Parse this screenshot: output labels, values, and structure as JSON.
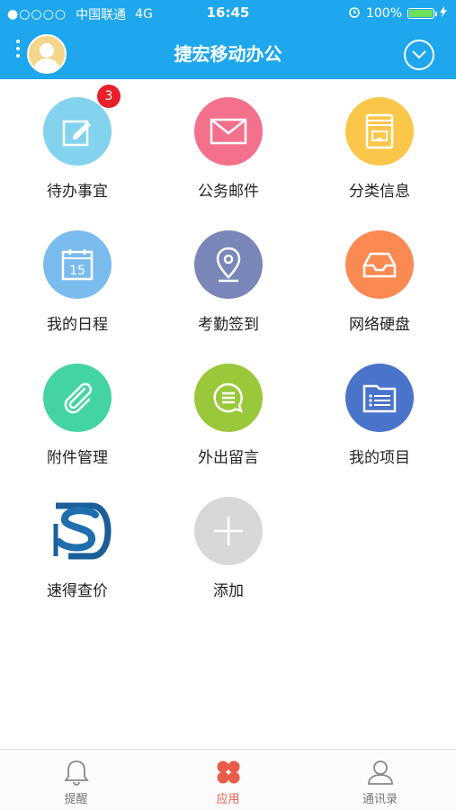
{
  "status": {
    "signal": "●○○○○",
    "carrier": "中国联通",
    "network": "4G",
    "time": "16:45",
    "battery": "100%"
  },
  "header": {
    "title": "捷宏移动办公"
  },
  "apps": [
    {
      "label": "待办事宜",
      "badge": "3",
      "color": "#83d3ee",
      "icon": "edit-icon"
    },
    {
      "label": "公务邮件",
      "color": "#f3718c",
      "icon": "mail-icon"
    },
    {
      "label": "分类信息",
      "color": "#fbc74a",
      "icon": "info-box-icon"
    },
    {
      "label": "我的日程",
      "color": "#7bbcef",
      "icon": "calendar-icon",
      "calendar_day": "15"
    },
    {
      "label": "考勤签到",
      "color": "#7b86b8",
      "icon": "location-icon"
    },
    {
      "label": "网络硬盘",
      "color": "#fb8a52",
      "icon": "tray-icon"
    },
    {
      "label": "附件管理",
      "color": "#44d4a4",
      "icon": "paperclip-icon"
    },
    {
      "label": "外出留言",
      "color": "#9bc83b",
      "icon": "chat-icon"
    },
    {
      "label": "我的项目",
      "color": "#4a74c9",
      "icon": "folder-list-icon"
    },
    {
      "label": "速得查价",
      "icon": "sd-logo"
    },
    {
      "label": "添加",
      "color": "#d8d8d8",
      "icon": "plus-icon"
    }
  ],
  "tabs": [
    {
      "label": "提醒",
      "icon": "bell-icon"
    },
    {
      "label": "应用",
      "icon": "clover-icon",
      "active": true
    },
    {
      "label": "通讯录",
      "icon": "person-icon"
    }
  ],
  "colors": {
    "header": "#1ea7ec",
    "accent": "#e85c4a"
  }
}
